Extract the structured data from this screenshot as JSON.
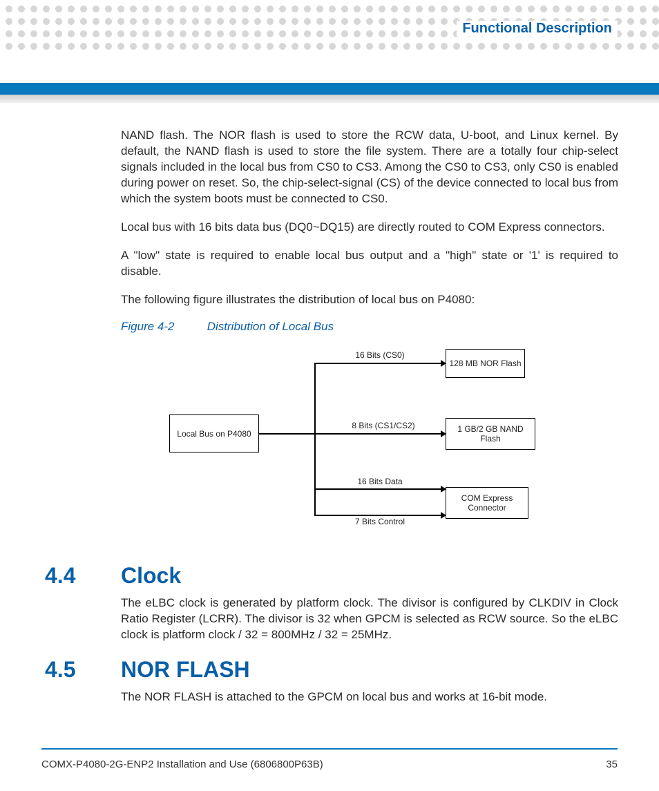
{
  "header": {
    "section_title": "Functional Description"
  },
  "body": {
    "p1": "NAND flash. The NOR flash is used to store the RCW data, U-boot, and Linux kernel. By default, the NAND flash is used to store the file system. There are a totally four chip-select signals included in the local bus from CS0 to CS3. Among the CS0 to CS3, only CS0 is enabled during power on reset. So, the chip-select-signal (CS) of the device connected to local bus from which the system boots must be connected to CS0.",
    "p2": "Local bus with 16 bits data bus (DQ0~DQ15) are directly routed to COM Express connectors.",
    "p3": "A \"low\" state is required to enable local bus output and a \"high\" state or '1' is required to disable.",
    "p4": "The following figure illustrates the distribution of local bus on P4080:",
    "figure": {
      "label_num": "Figure 4-2",
      "label_text": "Distribution of Local Bus",
      "box_localbus": "Local Bus on P4080",
      "box_nor": "128 MB NOR Flash",
      "box_nand": "1 GB/2 GB NAND Flash",
      "box_com": "COM Express Connector",
      "edge_top": "16 Bits (CS0)",
      "edge_mid": "8 Bits (CS1/CS2)",
      "edge_data": "16 Bits Data",
      "edge_ctrl": "7 Bits Control"
    },
    "s44_num": "4.4",
    "s44_title": "Clock",
    "s44_p": "The eLBC clock is generated by platform clock. The divisor is configured by CLKDIV in Clock Ratio Register (LCRR). The divisor is 32 when GPCM is selected as RCW source. So the eLBC clock is platform clock / 32 = 800MHz / 32 = 25MHz.",
    "s45_num": "4.5",
    "s45_title": "NOR FLASH",
    "s45_p": "The NOR FLASH is attached to the GPCM on local bus and works at 16-bit mode."
  },
  "footer": {
    "doc": "COMX-P4080-2G-ENP2 Installation and Use (6806800P63B)",
    "page": "35"
  }
}
